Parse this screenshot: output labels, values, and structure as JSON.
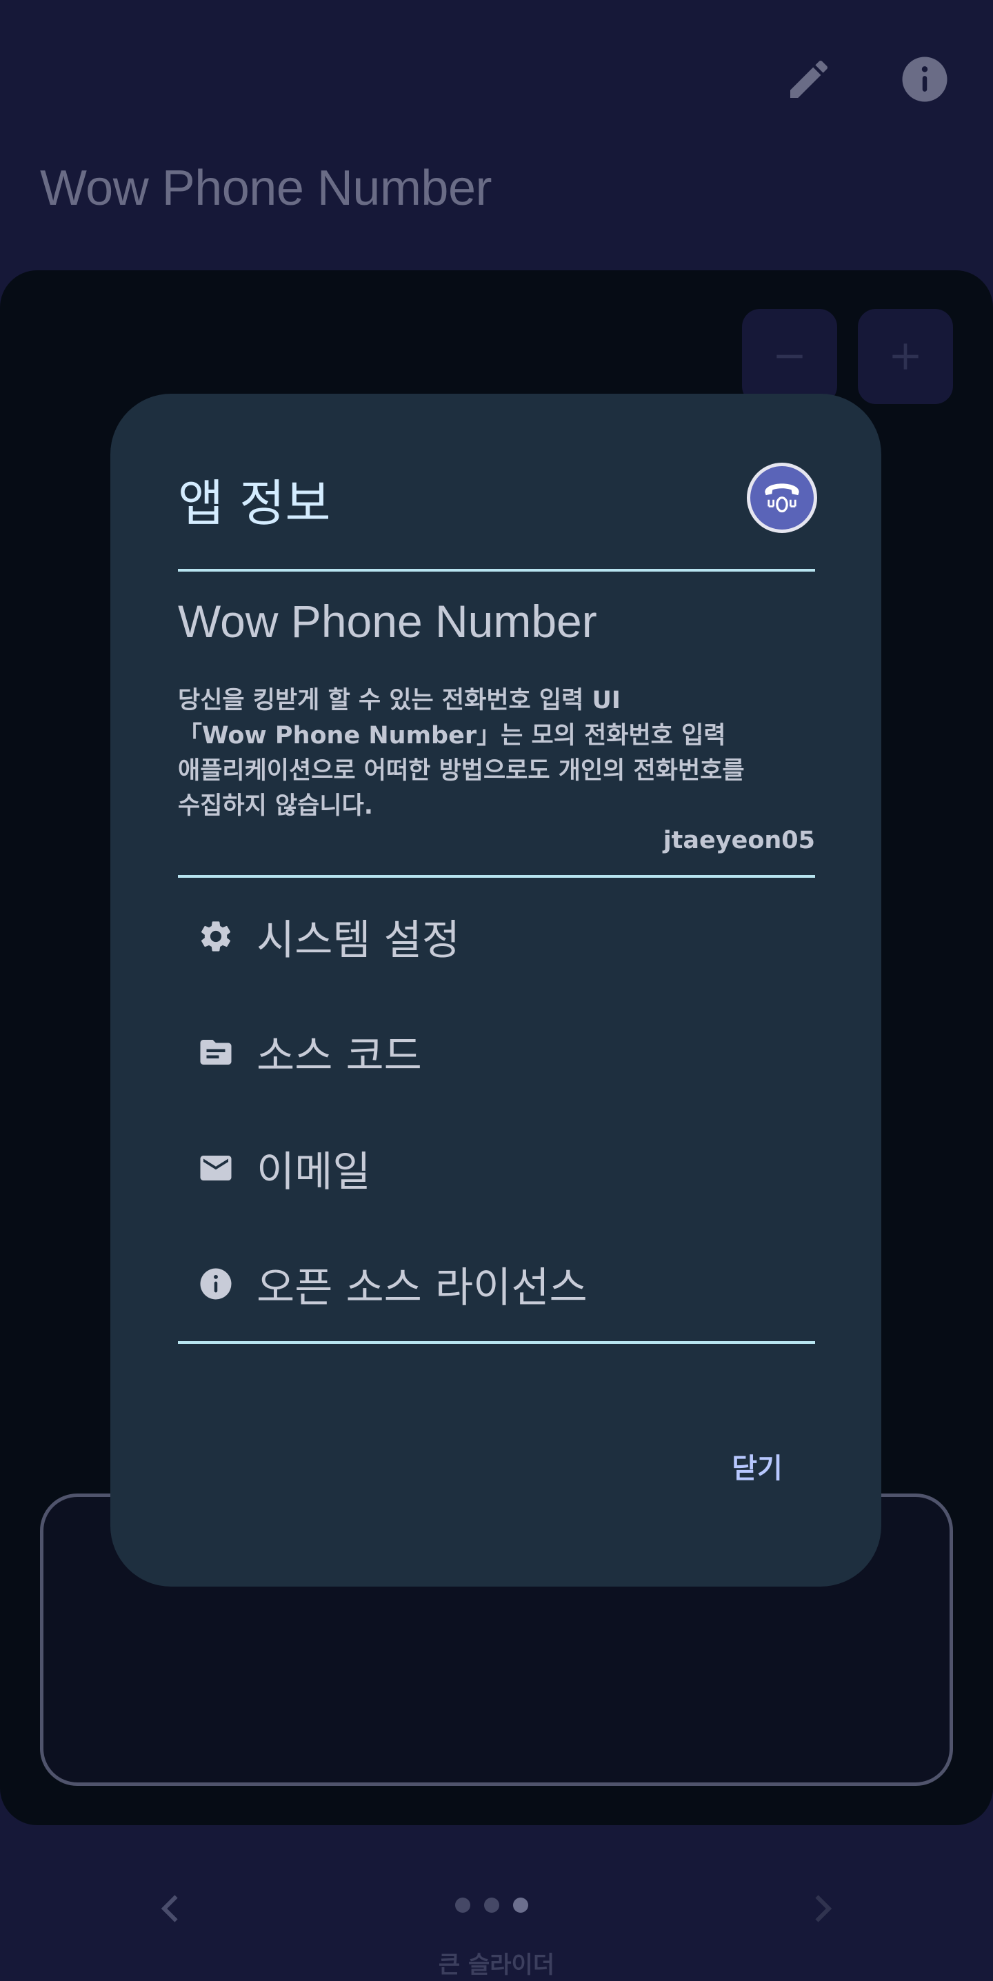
{
  "topbar": {
    "edit_icon": "pencil-icon",
    "info_icon": "info-icon"
  },
  "app_title": "Wow Phone Number",
  "controls": {
    "minus_icon": "minus-icon",
    "plus_icon": "plus-icon"
  },
  "dialog": {
    "title": "앱 정보",
    "logo_icon": "phone-logo-icon",
    "app_name": "Wow Phone Number",
    "description": "당신을 킹받게 할 수 있는 전화번호 입력 UI\n「Wow Phone Number」는 모의 전화번호 입력\n애플리케이션으로 어떠한 방법으로도 개인의 전화번호를\n수집하지 않습니다.",
    "author": "jtaeyeon05",
    "menu": [
      {
        "label": "시스템 설정",
        "icon": "gear-icon"
      },
      {
        "label": "소스 코드",
        "icon": "folder-icon"
      },
      {
        "label": "이메일",
        "icon": "mail-icon"
      },
      {
        "label": "오픈 소스 라이선스",
        "icon": "info-icon"
      }
    ],
    "close_label": "닫기"
  },
  "pager": {
    "prev_icon": "chevron-left-icon",
    "next_icon": "chevron-right-icon",
    "pages": 3,
    "active_page": 3,
    "label": "큰 슬라이더"
  },
  "colors": {
    "background": "#161838",
    "panel": "#060c15",
    "dialog": "#1e2f3f",
    "accent": "#5a64b8",
    "divider": "#b8e4f0"
  }
}
